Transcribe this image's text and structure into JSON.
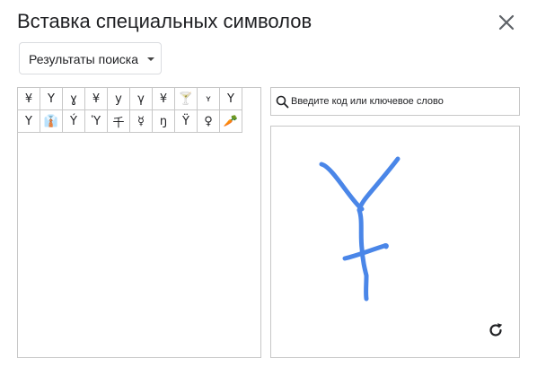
{
  "dialog": {
    "title": "Вставка специальных символов",
    "category_dropdown": "Результаты поиска"
  },
  "search": {
    "placeholder": "Введите код или ключевое слово"
  },
  "symbols": [
    {
      "char": "¥",
      "name": "yen-sign"
    },
    {
      "char": "Y",
      "name": "latin-capital-y"
    },
    {
      "char": "ɣ",
      "name": "latin-small-gamma"
    },
    {
      "char": "¥",
      "name": "fullwidth-yen-sign"
    },
    {
      "char": "y",
      "name": "latin-small-y"
    },
    {
      "char": "γ",
      "name": "greek-small-gamma"
    },
    {
      "char": "¥",
      "name": "yen-sign-bold"
    },
    {
      "char": "🍸",
      "name": "cocktail-glass-emoji"
    },
    {
      "char": "ʏ",
      "name": "small-capital-y"
    },
    {
      "char": "Ү",
      "name": "cyrillic-straight-u"
    },
    {
      "char": "Y",
      "name": "mathematical-y"
    },
    {
      "char": "👔",
      "name": "necktie-emoji"
    },
    {
      "char": "Ý",
      "name": "latin-y-acute"
    },
    {
      "char": "Ὑ",
      "name": "greek-upsilon"
    },
    {
      "char": "千",
      "name": "cjk-thousand"
    },
    {
      "char": "☿",
      "name": "mercury-symbol"
    },
    {
      "char": "ŋ",
      "name": "latin-small-eng"
    },
    {
      "char": "Ÿ",
      "name": "latin-y-diaeresis"
    },
    {
      "char": "♀",
      "name": "female-sign"
    },
    {
      "char": "🥕",
      "name": "carrot-emoji"
    }
  ],
  "colors": {
    "stroke": "#4a86e8",
    "border": "#c7c7c7",
    "text": "#202124"
  },
  "icons": {
    "close": "close-icon",
    "search": "search-icon",
    "refresh": "refresh-icon",
    "dropdown": "caret-down-icon"
  }
}
